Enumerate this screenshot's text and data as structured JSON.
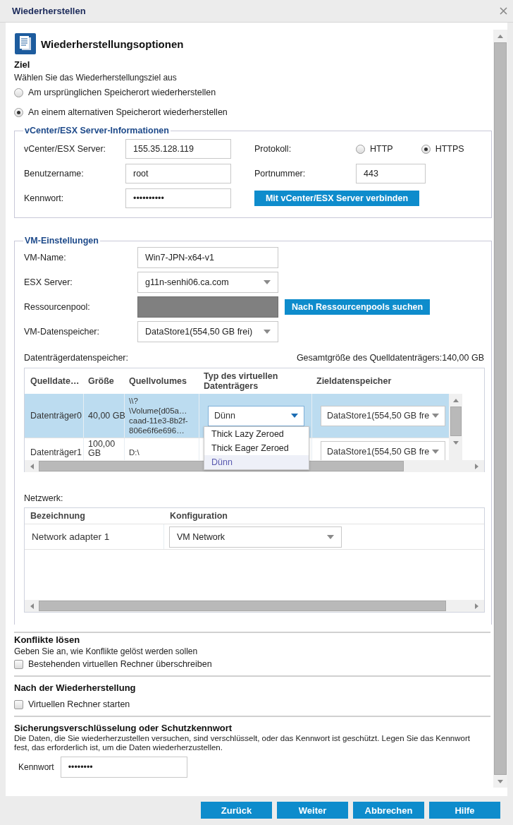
{
  "window": {
    "title": "Wiederherstellen"
  },
  "heading": "Wiederherstellungsoptionen",
  "destination": {
    "title": "Ziel",
    "hint": "Wählen Sie das Wiederherstellungsziel aus",
    "options": [
      {
        "label": "Am ursprünglichen Speicherort wiederherstellen",
        "selected": false
      },
      {
        "label": "An einem alternativen Speicherort wiederherstellen",
        "selected": true
      }
    ]
  },
  "server_info": {
    "legend": "vCenter/ESX Server-Informationen",
    "server_label": "vCenter/ESX Server:",
    "server": "155.35.128.119",
    "user_label": "Benutzername:",
    "user": "root",
    "password_label": "Kennwort:",
    "password": "••••••••••",
    "protocol_label": "Protokoll:",
    "protocols": [
      {
        "label": "HTTP",
        "selected": false
      },
      {
        "label": "HTTPS",
        "selected": true
      }
    ],
    "port_label": "Portnummer:",
    "port": "443",
    "connect_button": "Mit vCenter/ESX Server verbinden"
  },
  "vm_settings": {
    "legend": "VM-Einstellungen",
    "fields": [
      {
        "kind": "text",
        "label": "VM-Name:",
        "value": "Win7-JPN-x64-v1"
      },
      {
        "kind": "select",
        "label": "ESX Server:",
        "value": "g11n-senhi06.ca.com"
      },
      {
        "kind": "disabled",
        "label": "Ressourcenpool:",
        "button": "Nach Ressourcenpools suchen"
      },
      {
        "kind": "select",
        "label": "VM-Datenspeicher:",
        "value": "DataStore1(554,50 GB frei)"
      }
    ],
    "disk_label": "Datenträgerdatenspeicher:",
    "disk_total": "Gesamtgröße des Quelldatenträgers:140,00 GB",
    "disk_table": {
      "columns": [
        "Quelldate…",
        "Größe",
        "Quellvolumes",
        "Typ des virtuellen Datenträgers",
        "Zieldatenspeicher"
      ],
      "rows": [
        {
          "selected": true,
          "disk": "Datenträger0",
          "size": "40,00 GB",
          "volumes": "\\\\?\n\\Volume{d05a…\ncaad-11e3-8b2f-\n806e6f6e696…",
          "type": "Dünn",
          "target": "DataStore1(554,50 GB fre"
        },
        {
          "selected": false,
          "disk": "Datenträger1",
          "size": "100,00 GB",
          "volumes": "D:\\",
          "target": "DataStore1(554,50 GB fre"
        }
      ],
      "dropdown": [
        {
          "label": "Thick Lazy Zeroed",
          "selected": false
        },
        {
          "label": "Thick Eager Zeroed",
          "selected": false
        },
        {
          "label": "Dünn",
          "selected": true
        }
      ]
    },
    "network": {
      "label": "Netzwerk:",
      "columns": [
        "Bezeichnung",
        "Konfiguration"
      ],
      "rows": [
        {
          "name": "Network adapter 1",
          "config": "VM Network"
        }
      ]
    }
  },
  "conflicts": {
    "title": "Konflikte lösen",
    "hint": "Geben Sie an, wie Konflikte gelöst werden sollen",
    "options": [
      {
        "label": "Bestehenden virtuellen Rechner überschreiben",
        "checked": false
      }
    ]
  },
  "after_restore": {
    "title": "Nach der Wiederherstellung",
    "options": [
      {
        "label": "Virtuellen Rechner starten",
        "checked": false
      }
    ]
  },
  "encryption": {
    "title": "Sicherungsverschlüsselung oder Schutzkennwort",
    "text": "Die Daten, die Sie wiederherzustellen versuchen, sind verschlüsselt, oder das Kennwort ist geschützt. Legen Sie das Kennwort fest, das erforderlich ist, um die Daten wiederherzustellen.",
    "password_label": "Kennwort",
    "password": "••••••••"
  },
  "buttons": [
    "Zurück",
    "Weiter",
    "Abbrechen",
    "Hilfe"
  ]
}
